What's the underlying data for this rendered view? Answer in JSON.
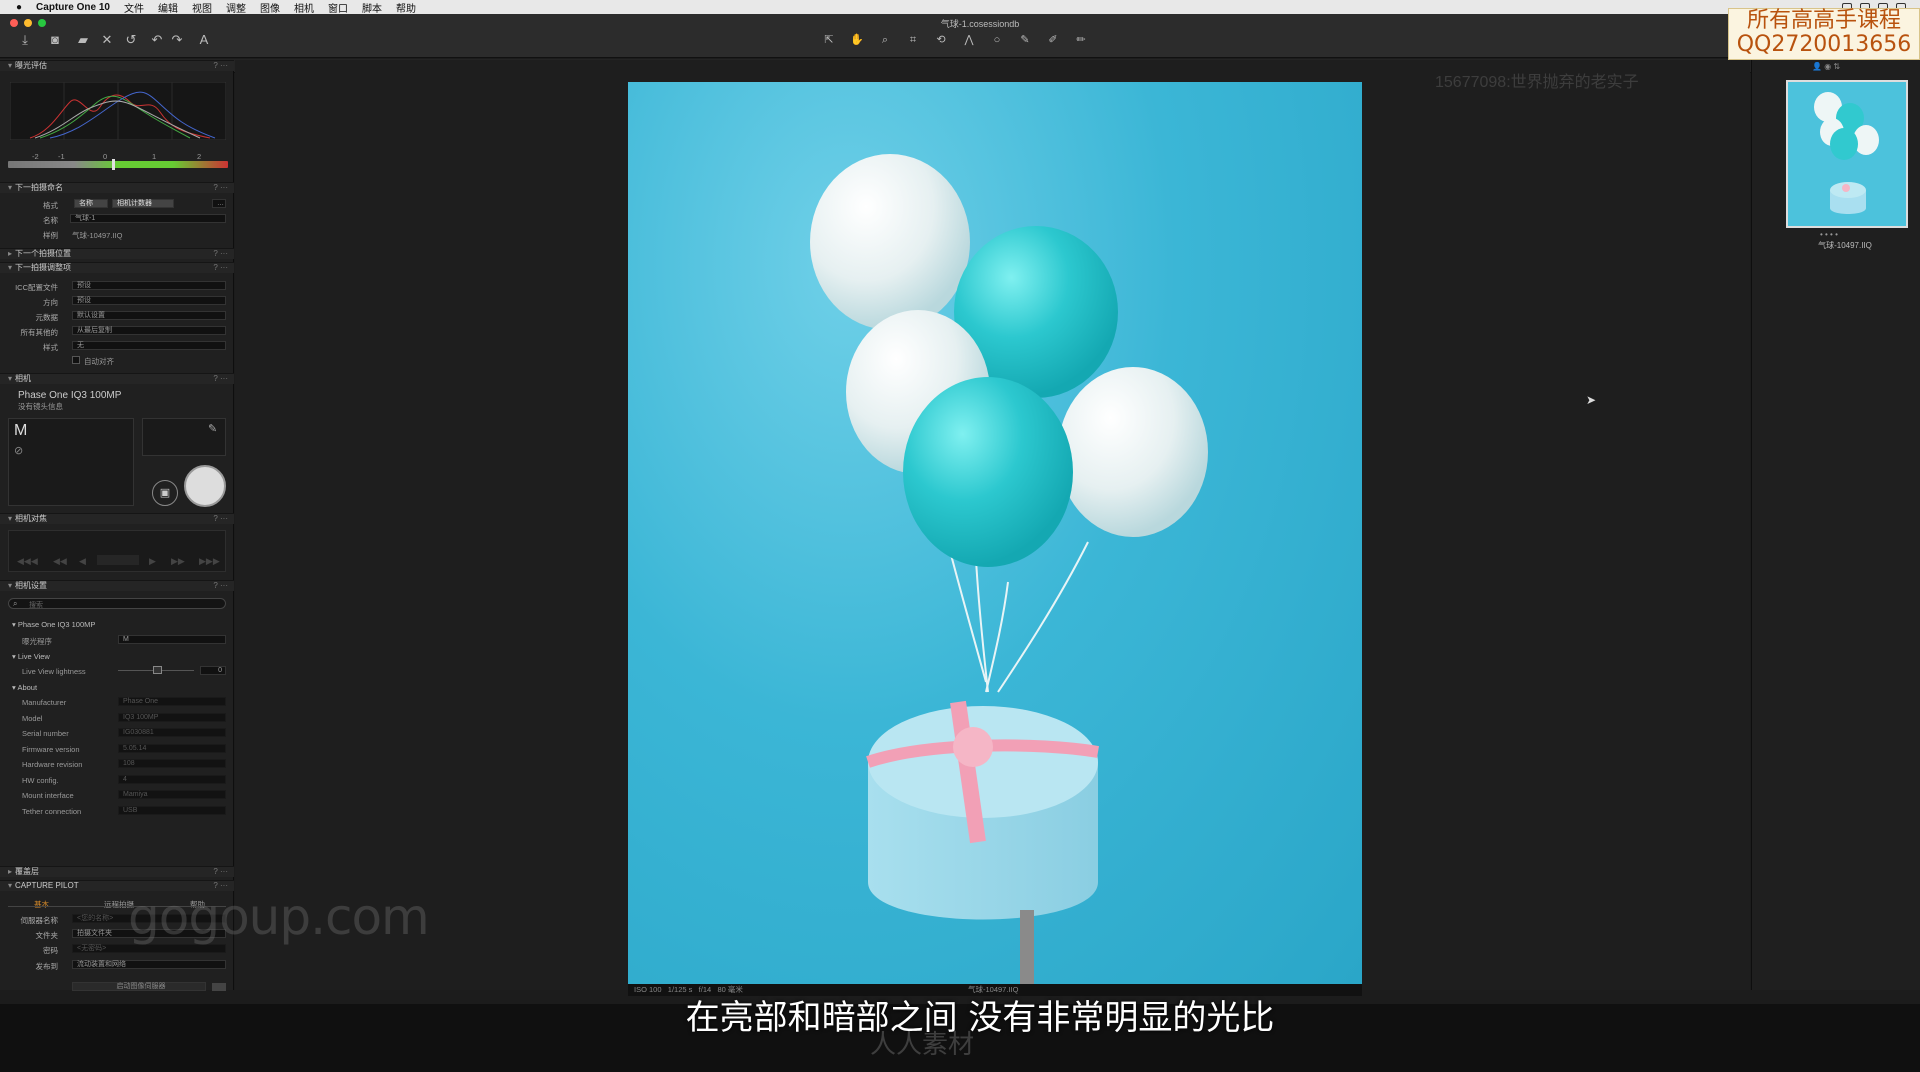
{
  "menubar": {
    "app_name": "Capture One 10",
    "items": [
      "文件",
      "编辑",
      "视图",
      "调整",
      "图像",
      "相机",
      "窗口",
      "脚本",
      "帮助"
    ]
  },
  "window": {
    "title": "气球-1.cosessiondb"
  },
  "overlay": {
    "qq_line1": "所有高高手课程",
    "qq_line2": "QQ2720013656",
    "watermark_id": "15677098:世界抛弃的老实子",
    "gogoup": "gogoup.com",
    "renren": "人人素材",
    "subtitle": "在亮部和暗部之间 没有非常明显的光比"
  },
  "left_panel": {
    "exposure_section": "曝光评估",
    "hist_ticks": [
      "-2",
      "-1",
      "0",
      "1",
      "2"
    ],
    "next_name_section": "下一拍摄命名",
    "format_label": "格式",
    "format_chip1": "名称",
    "format_chip2": "相机计数器",
    "name_label": "名称",
    "name_value": "气球-1",
    "sample_label": "样例",
    "sample_value": "气球-10497.IIQ",
    "next_location_section": "下一个拍摄位置",
    "next_adjust_section": "下一拍摄调整项",
    "icc_label": "ICC配置文件",
    "icc_value": "预设",
    "orient_label": "方向",
    "orient_value": "预设",
    "meta_label": "元数据",
    "meta_value": "默认设置",
    "other_label": "所有其他的",
    "other_value": "从最后复制",
    "style_label": "样式",
    "style_value": "无",
    "auto_align": "自动对齐",
    "camera_section": "相机",
    "camera_model": "Phase One IQ3 100MP",
    "no_lens": "没有镜头信息",
    "mode": "M",
    "focus_section": "相机对焦",
    "settings_section": "相机设置",
    "search_placeholder": "搜索",
    "tree_camera": "Phase One IQ3 100MP",
    "exposure_program_label": "曝光程序",
    "exposure_program_value": "M",
    "live_view": "Live View",
    "live_view_lightness_label": "Live View lightness",
    "live_view_lightness_value": "0",
    "about": "About",
    "about_rows": [
      {
        "k": "Manufacturer",
        "v": "Phase One"
      },
      {
        "k": "Model",
        "v": "IQ3 100MP"
      },
      {
        "k": "Serial number",
        "v": "IG030881"
      },
      {
        "k": "Firmware version",
        "v": "5.05.14"
      },
      {
        "k": "Hardware revision",
        "v": "108"
      },
      {
        "k": "HW config.",
        "v": "4"
      },
      {
        "k": "Mount interface",
        "v": "Mamiya"
      },
      {
        "k": "Tether connection",
        "v": "USB"
      }
    ],
    "overlay_section": "覆盖层",
    "capture_pilot_section": "CAPTURE PILOT",
    "cp_tab1": "基本",
    "cp_tab2": "远程拍摄",
    "cp_tab3": "帮助",
    "cp_server_label": "伺服器名称",
    "cp_server_value": "<您的名称>",
    "cp_folder_label": "文件夹",
    "cp_folder_value": "拍摄文件夹",
    "cp_password_label": "密码",
    "cp_password_value": "<无密码>",
    "cp_publish_label": "发布到",
    "cp_publish_value": "流动装置和网络",
    "cp_start_button": "启动图像伺服器"
  },
  "viewer": {
    "info_iso": "ISO 100",
    "info_shutter": "1/125 s",
    "info_aperture": "f/14",
    "info_focal": "80 毫米",
    "info_file": "气球-10497.IIQ"
  },
  "browser": {
    "thumb_name": "气球-10497.IIQ",
    "dots": "• • • •"
  },
  "colors": {
    "accent": "#e0902a",
    "backdrop": "#3bb6d6",
    "balloon_teal": "#2fc6cf",
    "balloon_white": "#e8f2f2",
    "ribbon": "#f2a0b6"
  }
}
